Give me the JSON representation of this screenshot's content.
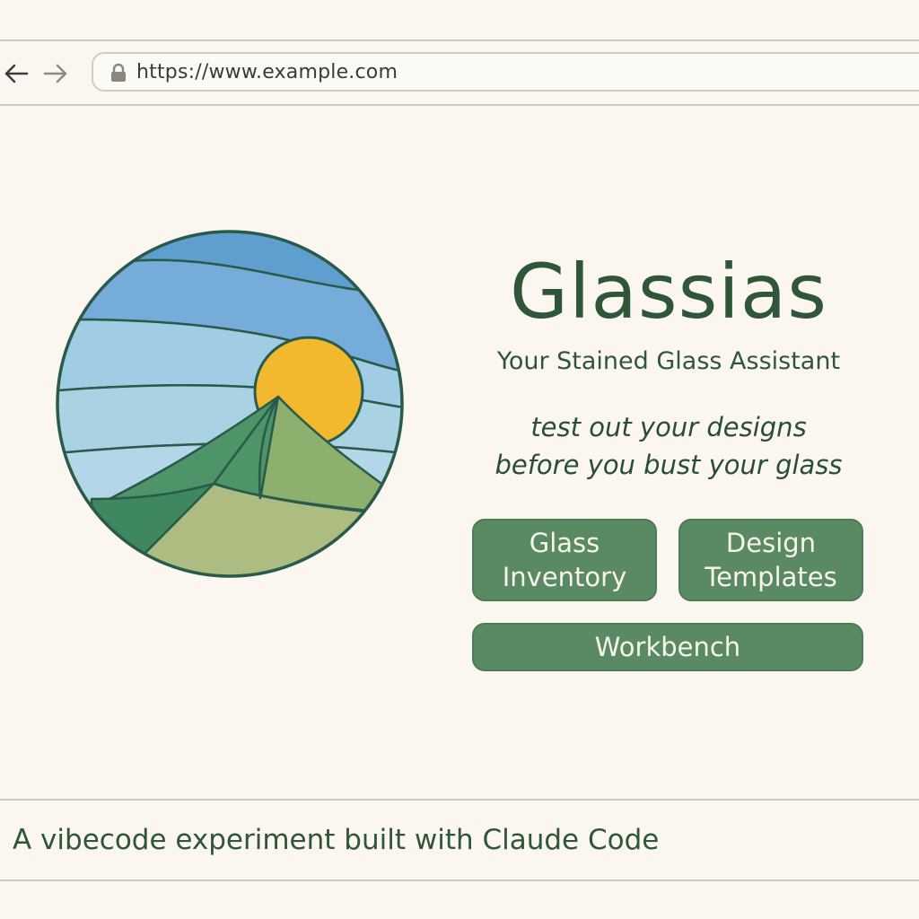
{
  "browser": {
    "url": "https://www.example.com",
    "back_icon": "arrow-left-icon",
    "forward_icon": "arrow-right-icon",
    "lock_icon": "lock-icon"
  },
  "hero": {
    "title": "Glassias",
    "subtitle": "Your Stained Glass Assistant",
    "tagline_line1": "test out your designs",
    "tagline_line2": "before you bust your glass"
  },
  "buttons": {
    "inventory_line1": "Glass",
    "inventory_line2": "Inventory",
    "templates_line1": "Design",
    "templates_line2": "Templates",
    "workbench": "Workbench"
  },
  "footer": {
    "text": "A vibecode experiment built with Claude Code"
  },
  "colors": {
    "background": "#fbf7f0",
    "primary_text": "#2f5639",
    "button_bg": "#5a8a63",
    "button_text": "#f7f4ec",
    "sun": "#f2b82e",
    "sky_dark": "#5f9fd0",
    "sky_light": "#a9d3e3"
  }
}
